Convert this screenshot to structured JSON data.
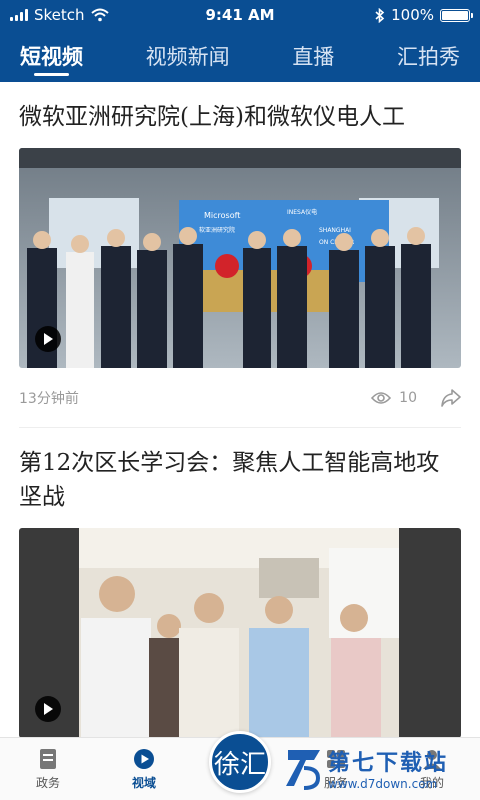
{
  "status": {
    "carrier": "Sketch",
    "time": "9:41 AM",
    "battery": "100%",
    "battery_level": 1.0
  },
  "nav": {
    "tabs": [
      {
        "label": "短视频",
        "active": true
      },
      {
        "label": "视频新闻",
        "active": false
      },
      {
        "label": "直播",
        "active": false
      },
      {
        "label": "汇拍秀",
        "active": false
      }
    ]
  },
  "articles": [
    {
      "title": "微软亚洲研究院(上海)和微软仪电人工",
      "time": "13分钟前",
      "views": "10"
    },
    {
      "title": "第12次区长学习会：聚焦人工智能高地攻坚战"
    }
  ],
  "video1_signs": {
    "brand": "Microsoft",
    "partner": "INESA仪电",
    "left_line": "软亚洲研究院",
    "right_line": "SHANGHAI",
    "right_line2": "ON CENTER"
  },
  "tabbar": {
    "items": [
      {
        "label": "政务",
        "active": false
      },
      {
        "label": "视域",
        "active": true
      },
      {
        "label": "服务",
        "active": false
      },
      {
        "label": "我的",
        "active": false
      }
    ],
    "logo_text": "徐汇"
  },
  "watermark": {
    "cn": "第七下载站",
    "url": "www.d7down.com"
  },
  "colors": {
    "brand": "#0a4e93",
    "meta": "#9a9a9a"
  }
}
